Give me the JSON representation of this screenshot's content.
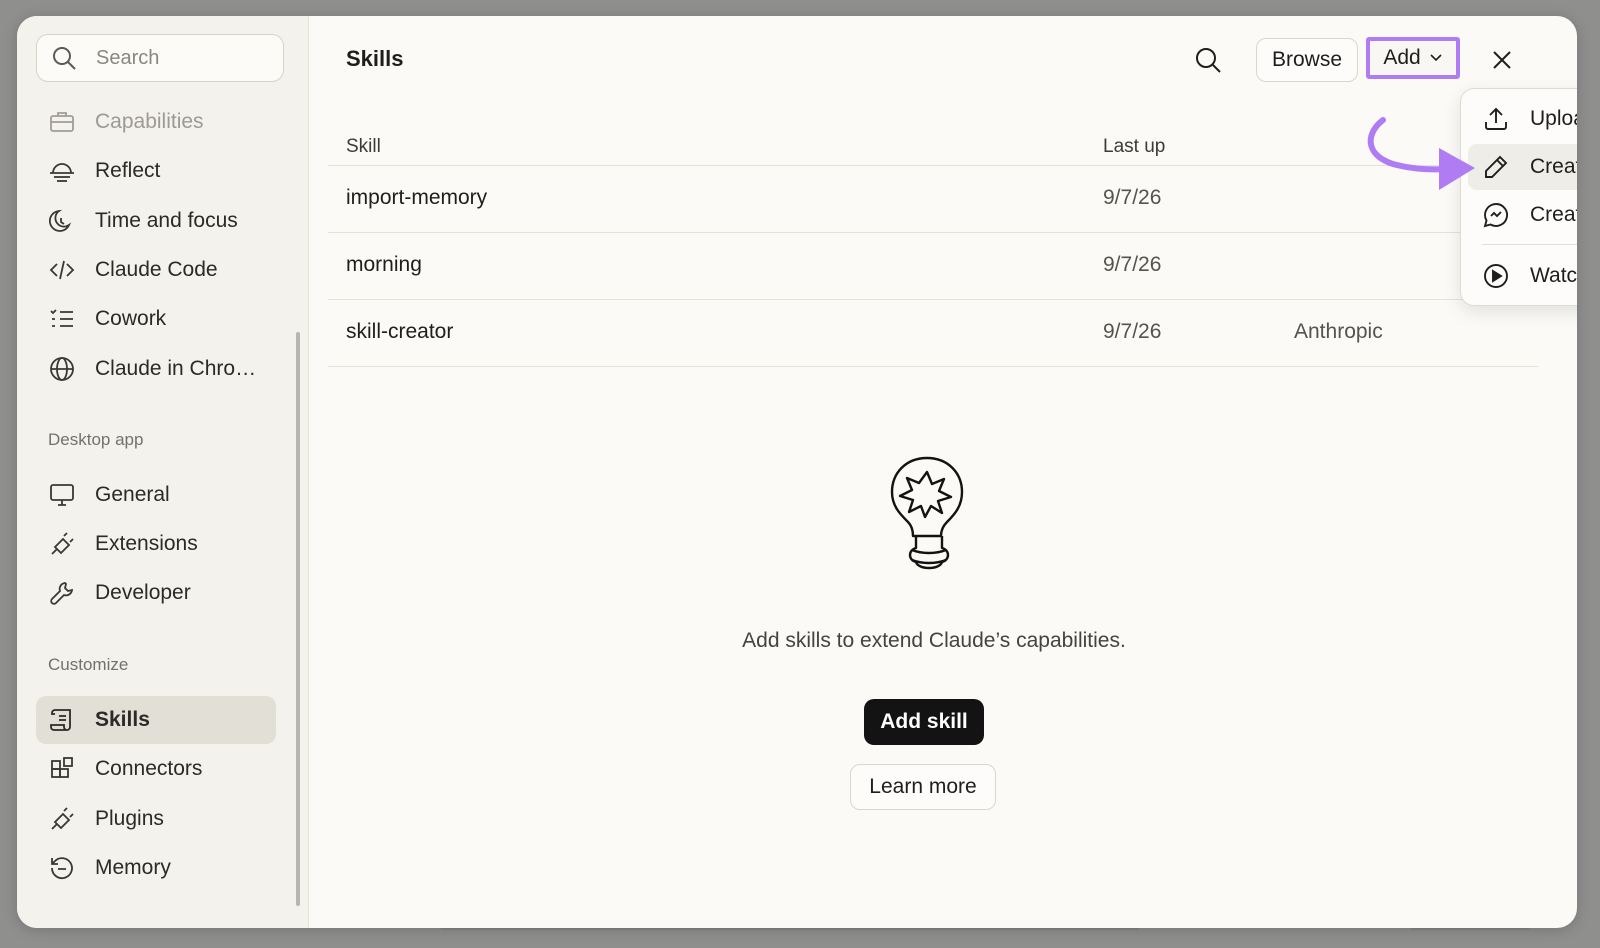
{
  "sidebar": {
    "search_placeholder": "Search",
    "items_top": [
      {
        "label": "Capabilities",
        "icon": "briefcase-icon"
      },
      {
        "label": "Reflect",
        "icon": "sunset-icon"
      },
      {
        "label": "Time and focus",
        "icon": "moon-clock-icon"
      },
      {
        "label": "Claude Code",
        "icon": "code-icon"
      },
      {
        "label": "Cowork",
        "icon": "checklist-icon"
      },
      {
        "label": "Claude in Chro…",
        "icon": "globe-icon"
      }
    ],
    "section_desktop": "Desktop app",
    "items_desktop": [
      {
        "label": "General",
        "icon": "monitor-icon"
      },
      {
        "label": "Extensions",
        "icon": "plug-icon"
      },
      {
        "label": "Developer",
        "icon": "wrench-icon"
      }
    ],
    "section_customize": "Customize",
    "items_customize": [
      {
        "label": "Skills",
        "icon": "scroll-icon",
        "active": true
      },
      {
        "label": "Connectors",
        "icon": "blocks-icon"
      },
      {
        "label": "Plugins",
        "icon": "plug-icon"
      },
      {
        "label": "Memory",
        "icon": "history-icon"
      }
    ]
  },
  "header": {
    "title": "Skills",
    "browse_label": "Browse",
    "add_label": "Add"
  },
  "table": {
    "col_skill": "Skill",
    "col_updated": "Last up",
    "rows": [
      {
        "name": "import-memory",
        "date": "9/7/26",
        "source": ""
      },
      {
        "name": "morning",
        "date": "9/7/26",
        "source": ""
      },
      {
        "name": "skill-creator",
        "date": "9/7/26",
        "source": "Anthropic"
      }
    ]
  },
  "empty_state": {
    "text": "Add skills to extend Claude’s capabilities.",
    "primary_label": "Add skill",
    "secondary_label": "Learn more"
  },
  "add_menu": {
    "items": [
      {
        "label": "Upload skill",
        "icon": "upload-icon"
      },
      {
        "label": "Create a skill",
        "icon": "pencil-icon",
        "highlighted": true
      },
      {
        "label": "Create with Claude",
        "icon": "chat-bubble-icon"
      },
      {
        "label": "Watch the intro video",
        "icon": "play-circle-icon"
      }
    ]
  },
  "colors": {
    "annotation_purple": "#b07cf3",
    "primary_button": "#131313",
    "sidebar_bg": "#f4f2ec"
  }
}
